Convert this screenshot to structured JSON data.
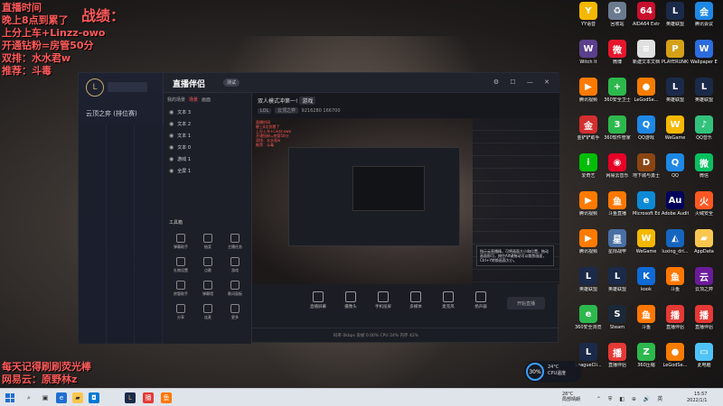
{
  "overlay": {
    "top_left_lines": [
      "直播时间",
      "晚上8点到累了",
      "上分上车+Linzz-owo",
      "开通钻粉=房管50分",
      "双排：水水君w",
      "推荐：斗毒"
    ],
    "score_label": "战绩：",
    "bottom_left_lines": [
      "每天记得刷刷荧光棒",
      "网易云：原野林z"
    ]
  },
  "lol_client": {
    "logo": "L",
    "game_item": "云顶之弈 (排位赛)"
  },
  "obs": {
    "title": "直播伴侣",
    "version_badge": "测试",
    "scene_tabs": [
      "我的场景",
      "场景",
      "画面"
    ],
    "sources": [
      "文本 3",
      "文本 2",
      "文本 1",
      "文本 0",
      "游戏 1",
      "全屏 1"
    ],
    "tools_title": "工具箱",
    "tools": [
      "弹幕助手",
      "抽奖",
      "主播任务",
      "礼物设置",
      "点歌",
      "游戏",
      "房管助手",
      "弹幕墙",
      "歌词面板",
      "分享",
      "连麦",
      "更多"
    ],
    "room_title": "双人模式冲第一!",
    "room_tag": "游戏",
    "room_meta_chips": [
      "LOL",
      "云顶之弈"
    ],
    "fans_count": "9216280",
    "viewers": "166700",
    "preview_overlay_lines": [
      "直播时间",
      "晚上8点到累了",
      "上分上车+Linzz-owo",
      "开通钻粉=房管50分",
      "双排：水水君w",
      "推荐：斗毒"
    ],
    "mini_note": "指示云直播精，可将画面大小和位置，拖动画面即可，按住Alt键拖动可以裁剪画面，Ctrl+Y转换画面大小。",
    "bottom_tools": [
      "直播屏幕",
      "摄像头",
      "手机投屏",
      "多媒体",
      "麦克风",
      "扬声器"
    ],
    "start_button": "开始直播",
    "status_text": "码率 0kbps   丢帧 0.00%   CPU 24%   内存 42%"
  },
  "desktop_icons": [
    {
      "label": "YY语音",
      "glyph": "Y",
      "color": "#f5b800",
      "col": 0,
      "row": 0
    },
    {
      "label": "回收站",
      "glyph": "♻",
      "color": "#6b7a8f",
      "col": 1,
      "row": 0
    },
    {
      "label": "AIDA64 Extreme",
      "glyph": "64",
      "color": "#c8102e",
      "col": 2,
      "row": 0
    },
    {
      "label": "英雄联盟",
      "glyph": "L",
      "color": "#1b2a49",
      "col": 3,
      "row": 0
    },
    {
      "label": "腾讯会议",
      "glyph": "会",
      "color": "#1e88e5",
      "col": 4,
      "row": 0
    },
    {
      "label": "Witch It",
      "glyph": "W",
      "color": "#5b3f8c",
      "col": 0,
      "row": 1
    },
    {
      "label": "微博",
      "glyph": "微",
      "color": "#e6162d",
      "col": 1,
      "row": 1
    },
    {
      "label": "新建文本文档",
      "glyph": "≡",
      "color": "#e0e0e0",
      "col": 2,
      "row": 1
    },
    {
      "label": "PLAYERUNKNOWN'S BATTLEGROUNDS",
      "glyph": "P",
      "color": "#d4a017",
      "col": 3,
      "row": 1
    },
    {
      "label": "Wallpaper Engine",
      "glyph": "W",
      "color": "#2d6cdf",
      "col": 4,
      "row": 1
    },
    {
      "label": "腾讯视频",
      "glyph": "▶",
      "color": "#ff7a00",
      "col": 0,
      "row": 2
    },
    {
      "label": "360安全卫士",
      "glyph": "+",
      "color": "#2db84d",
      "col": 1,
      "row": 2
    },
    {
      "label": "LeGodSe...",
      "glyph": "●",
      "color": "#f57c00",
      "col": 2,
      "row": 2
    },
    {
      "label": "英雄联盟",
      "glyph": "L",
      "color": "#1b2a49",
      "col": 3,
      "row": 2
    },
    {
      "label": "英雄联盟",
      "glyph": "L",
      "color": "#1b2a49",
      "col": 4,
      "row": 2
    },
    {
      "label": "金铲铲助手",
      "glyph": "金",
      "color": "#d32f2f",
      "col": 0,
      "row": 3
    },
    {
      "label": "360软件管家",
      "glyph": "3",
      "color": "#2db84d",
      "col": 1,
      "row": 3
    },
    {
      "label": "QQ游戏",
      "glyph": "Q",
      "color": "#1e88e5",
      "col": 2,
      "row": 3
    },
    {
      "label": "WeGame",
      "glyph": "W",
      "color": "#f5b800",
      "col": 3,
      "row": 3
    },
    {
      "label": "QQ音乐",
      "glyph": "♪",
      "color": "#31c27c",
      "col": 4,
      "row": 3
    },
    {
      "label": "爱奇艺",
      "glyph": "i",
      "color": "#00be06",
      "col": 0,
      "row": 4
    },
    {
      "label": "网易云音乐",
      "glyph": "◉",
      "color": "#e60026",
      "col": 1,
      "row": 4
    },
    {
      "label": "地下城与勇士",
      "glyph": "D",
      "color": "#8b4513",
      "col": 2,
      "row": 4
    },
    {
      "label": "QQ",
      "glyph": "Q",
      "color": "#1e88e5",
      "col": 3,
      "row": 4
    },
    {
      "label": "微信",
      "glyph": "微",
      "color": "#07c160",
      "col": 4,
      "row": 4
    },
    {
      "label": "腾讯视频",
      "glyph": "▶",
      "color": "#ff7a00",
      "col": 0,
      "row": 5
    },
    {
      "label": "斗鱼直播",
      "glyph": "鱼",
      "color": "#ff7700",
      "col": 1,
      "row": 5
    },
    {
      "label": "Microsoft Edge",
      "glyph": "e",
      "color": "#0c8ad6",
      "col": 2,
      "row": 5
    },
    {
      "label": "Adobe Audition",
      "glyph": "Au",
      "color": "#00005b",
      "col": 3,
      "row": 5
    },
    {
      "label": "火绒安全",
      "glyph": "火",
      "color": "#ff5722",
      "col": 4,
      "row": 5
    },
    {
      "label": "腾讯视频",
      "glyph": "▶",
      "color": "#ff7a00",
      "col": 0,
      "row": 6
    },
    {
      "label": "星际战甲",
      "glyph": "星",
      "color": "#4a6fa5",
      "col": 1,
      "row": 6
    },
    {
      "label": "WeGame",
      "glyph": "W",
      "color": "#f5b800",
      "col": 2,
      "row": 6
    },
    {
      "label": "luxing_dri...",
      "glyph": "◭",
      "color": "#1565c0",
      "col": 3,
      "row": 6
    },
    {
      "label": "AppData",
      "glyph": "▰",
      "color": "#f9c74f",
      "col": 4,
      "row": 6
    },
    {
      "label": "英雄联盟",
      "glyph": "L",
      "color": "#1b2a49",
      "col": 0,
      "row": 7
    },
    {
      "label": "英雄联盟",
      "glyph": "L",
      "color": "#1b2a49",
      "col": 1,
      "row": 7
    },
    {
      "label": "kook",
      "glyph": "K",
      "color": "#0f6ad6",
      "col": 2,
      "row": 7
    },
    {
      "label": "斗鱼",
      "glyph": "鱼",
      "color": "#ff7700",
      "col": 3,
      "row": 7
    },
    {
      "label": "云顶之弈",
      "glyph": "云",
      "color": "#6a1b9a",
      "col": 4,
      "row": 7
    },
    {
      "label": "360安全浏览器",
      "glyph": "e",
      "color": "#2db84d",
      "col": 0,
      "row": 8
    },
    {
      "label": "Steam",
      "glyph": "S",
      "color": "#1b2838",
      "col": 1,
      "row": 8
    },
    {
      "label": "斗鱼",
      "glyph": "鱼",
      "color": "#ff7700",
      "col": 2,
      "row": 8
    },
    {
      "label": "直播伴侣",
      "glyph": "播",
      "color": "#e53935",
      "col": 3,
      "row": 8
    },
    {
      "label": "直播伴侣",
      "glyph": "播",
      "color": "#e53935",
      "col": 4,
      "row": 8
    },
    {
      "label": "LeagueCli...",
      "glyph": "L",
      "color": "#1b2a49",
      "col": 0,
      "row": 9
    },
    {
      "label": "直播伴侣",
      "glyph": "播",
      "color": "#e53935",
      "col": 1,
      "row": 9
    },
    {
      "label": "360压缩",
      "glyph": "Z",
      "color": "#2db84d",
      "col": 2,
      "row": 9
    },
    {
      "label": "LeGodSe...",
      "glyph": "●",
      "color": "#f57c00",
      "col": 3,
      "row": 9
    },
    {
      "label": "此电脑",
      "glyph": "▭",
      "color": "#4fc3f7",
      "col": 4,
      "row": 9
    }
  ],
  "cpu_widget": {
    "percent": "30%",
    "temp": "24°C",
    "label": "CPU温度"
  },
  "taskbar": {
    "weather_temp": "28°C",
    "weather_desc": "局部晴朗",
    "time": "15:57",
    "date": "2022/1/1"
  }
}
